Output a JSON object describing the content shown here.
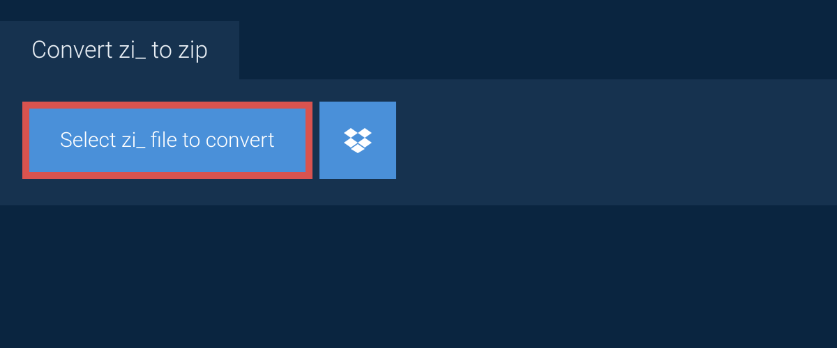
{
  "header": {
    "tab_title": "Convert zi_ to zip"
  },
  "actions": {
    "select_file_label": "Select zi_ file to convert",
    "dropbox_icon": "dropbox-icon"
  },
  "colors": {
    "background": "#0a2540",
    "panel": "#16324f",
    "button": "#4a90d9",
    "button_border": "#d9534f",
    "text": "#e8eef4"
  }
}
